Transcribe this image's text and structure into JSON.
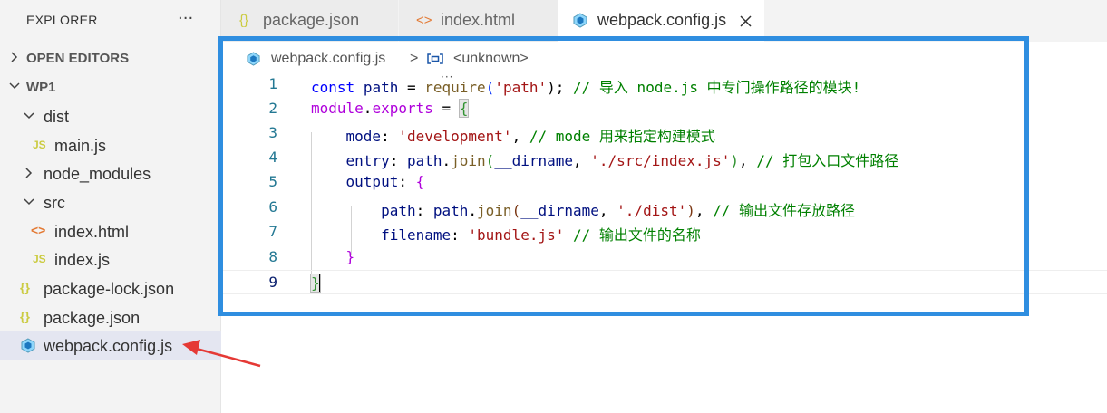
{
  "sidebar": {
    "title": "EXPLORER",
    "more": "···",
    "open_editors": "OPEN EDITORS",
    "folder": "WP1",
    "items": [
      {
        "label": "dist",
        "icon": ""
      },
      {
        "label": "main.js",
        "icon": "JS"
      },
      {
        "label": "node_modules",
        "icon": ""
      },
      {
        "label": "src",
        "icon": ""
      },
      {
        "label": "index.html",
        "icon": "<>"
      },
      {
        "label": "index.js",
        "icon": "JS"
      },
      {
        "label": "package-lock.json",
        "icon": "{}"
      },
      {
        "label": "package.json",
        "icon": "{}"
      },
      {
        "label": "webpack.config.js",
        "icon": "webpack-cube-icon"
      }
    ]
  },
  "tabs": [
    {
      "label": "package.json",
      "icon": "{}"
    },
    {
      "label": "index.html",
      "icon": "<>"
    },
    {
      "label": "webpack.config.js",
      "icon": "webpack-cube-icon",
      "active": true
    }
  ],
  "breadcrumb": {
    "file": "webpack.config.js",
    "separator": ">",
    "symbol": "<unknown>"
  },
  "code": {
    "line_numbers": [
      "1",
      "2",
      "3",
      "4",
      "5",
      "6",
      "7",
      "8",
      "9"
    ],
    "l1": {
      "kw": "const",
      "var": "path",
      "op": " = ",
      "fn": "require",
      "p": "(",
      "str": "'path'",
      "p2": ");",
      "cm": " // 导入 node.js 中专门操作路径的模块!"
    },
    "l2": {
      "var": "module",
      "dot": ".",
      "var2": "exports",
      "op": " = ",
      "b": "{"
    },
    "l3": {
      "key": "mode",
      "colon": ": ",
      "str": "'development'",
      "comma": ",",
      "cm": " // mode 用来指定构建模式"
    },
    "l4": {
      "key": "entry",
      "colon": ": ",
      "var": "path",
      "dot": ".",
      "fn": "join",
      "p": "(",
      "var2": "__dirname",
      "comma": ", ",
      "str": "'./src/index.js'",
      "p2": ")",
      "comma2": ",",
      "cm": " // 打包入口文件路径"
    },
    "l5": {
      "key": "output",
      "colon": ": ",
      "b": "{"
    },
    "l6": {
      "key": "path",
      "colon": ": ",
      "var": "path",
      "dot": ".",
      "fn": "join",
      "p": "(",
      "var2": "__dirname",
      "comma": ", ",
      "str": "'./dist'",
      "p2": ")",
      "comma2": ",",
      "cm": " // 输出文件存放路径"
    },
    "l7": {
      "key": "filename",
      "colon": ": ",
      "str": "'bundle.js'",
      "cm": " // 输出文件的名称"
    },
    "l8": {
      "b": "}"
    },
    "l9": {
      "b": "}"
    }
  },
  "colors": {
    "annotation_box": "#2f8ee0",
    "annotation_arrow": "#e53935",
    "js_icon": "#cbcb41",
    "json_icon": "#cbcb41",
    "html_icon": "#e37933",
    "webpack_icon": "#519aba"
  }
}
